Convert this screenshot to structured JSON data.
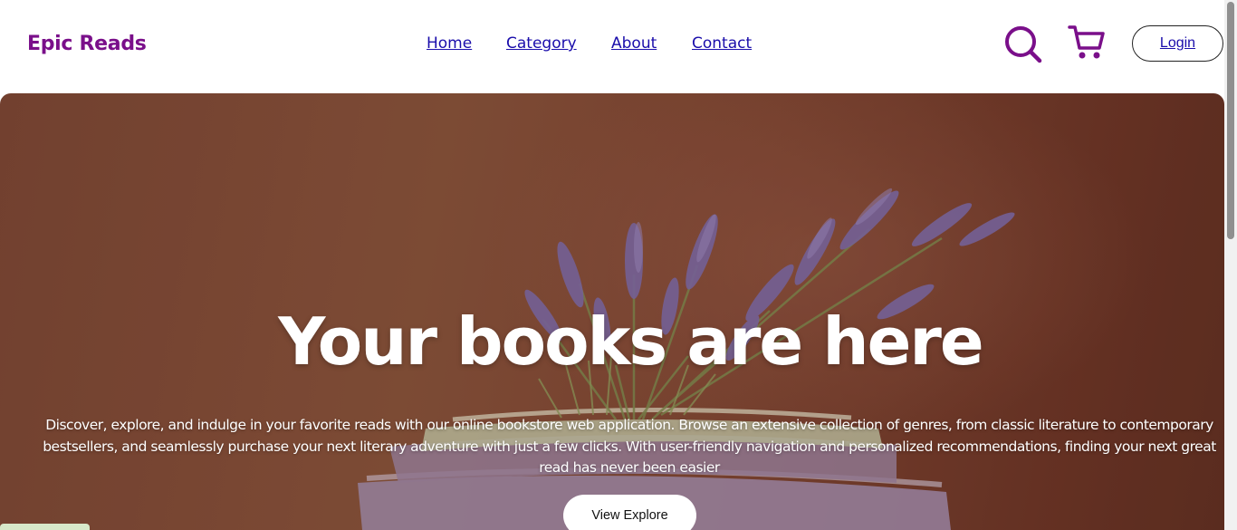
{
  "header": {
    "brand": "Epic Reads",
    "nav": [
      "Home",
      "Category",
      "About",
      "Contact"
    ],
    "login_label": "Login",
    "icons": {
      "search": "search-icon",
      "cart": "cart-icon"
    }
  },
  "hero": {
    "title": "Your books are here",
    "description": "Discover, explore, and indulge in your favorite reads with our online bookstore web application. Browse an extensive collection of genres, from classic literature to contemporary bestsellers, and seamlessly purchase your next literary adventure with just a few clicks. With user-friendly navigation and personalized recommendations, finding your next great read has never been easier",
    "cta_label": "View Explore"
  },
  "colors": {
    "brand": "#7a0f8a",
    "link": "#1a0dab",
    "hero_background": "#7a4634",
    "lavender": "#7d6aa6"
  }
}
